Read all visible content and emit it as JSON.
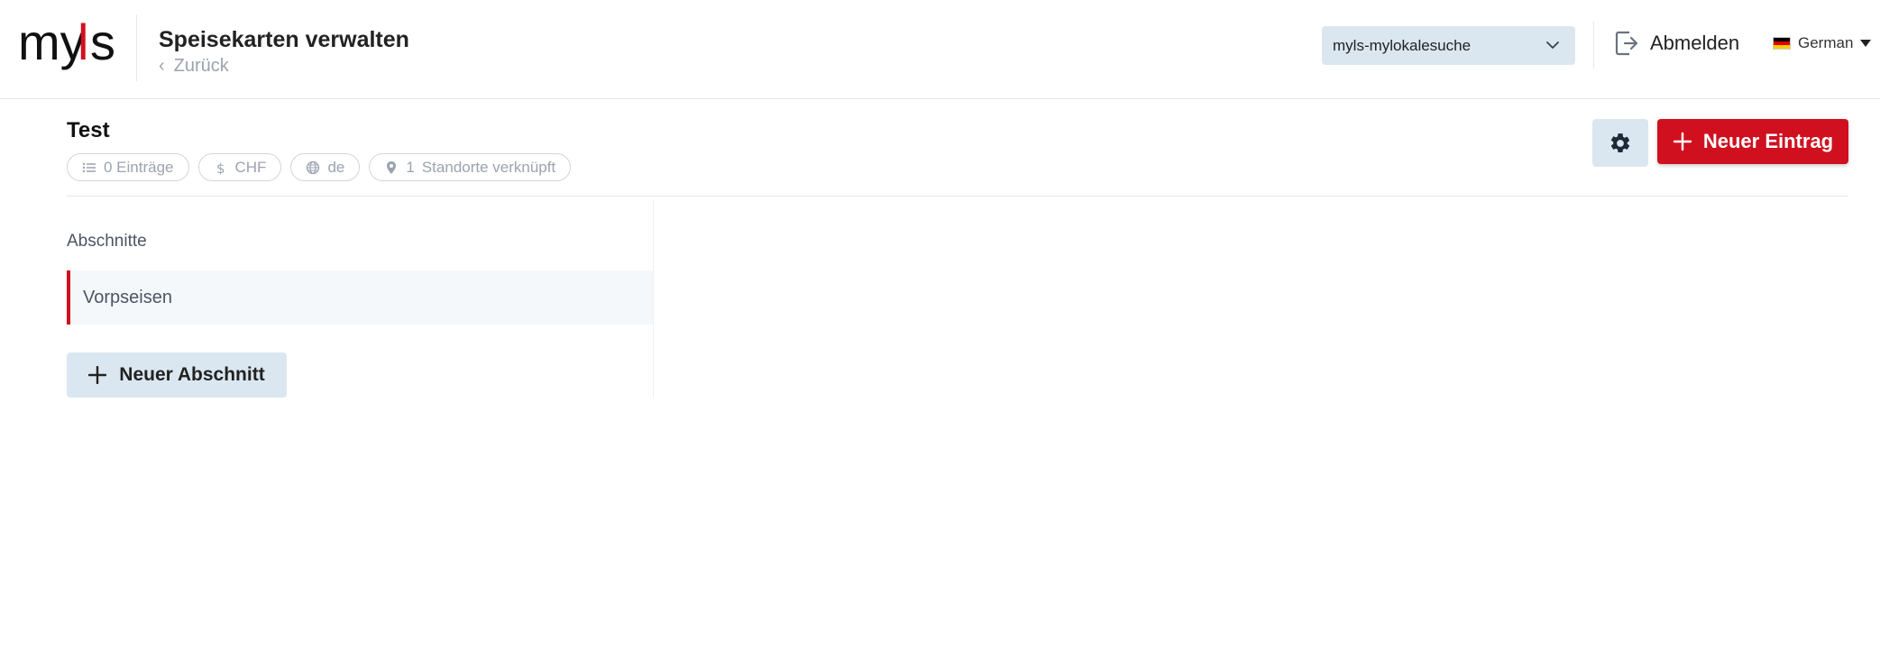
{
  "header": {
    "logo_text": "myls",
    "title": "Speisekarten verwalten",
    "back_label": "Zurück",
    "account_select_value": "myls-mylokalesuche",
    "logout_label": "Abmelden",
    "language_label": "German"
  },
  "menu": {
    "name": "Test",
    "chips": {
      "entries": "0 Einträge",
      "currency": "CHF",
      "language": "de",
      "locations_count": "1",
      "locations_label": "Standorte verknüpft"
    },
    "new_entry_label": "Neuer Eintrag"
  },
  "sections": {
    "heading": "Abschnitte",
    "items": [
      {
        "label": "Vorpseisen",
        "active": true
      }
    ],
    "new_section_label": "Neuer Abschnitt"
  },
  "colors": {
    "brand_red": "#d0101f",
    "control_blue": "#dbe7f0"
  },
  "icons": [
    "logout-icon",
    "chevron-left-icon",
    "chevron-down-icon",
    "list-icon",
    "dollar-icon",
    "globe-icon",
    "map-pin-icon",
    "gear-icon",
    "plus-icon",
    "german-flag-icon"
  ]
}
